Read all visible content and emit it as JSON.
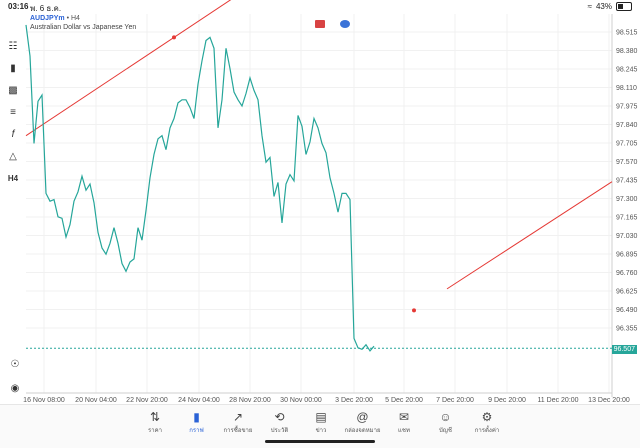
{
  "status_bar": {
    "time": "03:16",
    "date": "พ. 6 ธ.ค.",
    "battery_text": "43%",
    "battery_level": 0.43
  },
  "chart": {
    "symbol": "AUDJPYm",
    "timeframe": "• H4",
    "description": "Australian Dollar vs Japanese Yen",
    "current_price": "96.507",
    "colors": {
      "line": "#26a69a",
      "trendline": "#e53935",
      "grid": "#f1f1f1"
    }
  },
  "toolbar": [
    "crosshair-icon",
    "chart-type-icon",
    "indicators-icon",
    "objects-icon",
    "fx-icon",
    "shapes-icon",
    "H4"
  ],
  "tabs": [
    {
      "label": "ราคา",
      "icon": "arrows-icon",
      "active": false
    },
    {
      "label": "กราฟ",
      "icon": "candles-icon",
      "active": true
    },
    {
      "label": "การซื้อขาย",
      "icon": "trade-chart-icon",
      "active": false
    },
    {
      "label": "ประวัติ",
      "icon": "history-icon",
      "active": false
    },
    {
      "label": "ข่าว",
      "icon": "news-icon",
      "active": false
    },
    {
      "label": "กล่องจดหมาย",
      "icon": "mail-icon",
      "active": false
    },
    {
      "label": "แชท",
      "icon": "chat-icon",
      "active": false
    },
    {
      "label": "บัญชี",
      "icon": "account-icon",
      "active": false
    },
    {
      "label": "การตั้งค่า",
      "icon": "settings-icon",
      "active": false
    }
  ],
  "chart_data": {
    "type": "line",
    "title": "AUDJPYm • H4",
    "ylim": [
      96.22,
      98.65
    ],
    "y_ticks": [
      "98.515",
      "98.380",
      "98.245",
      "98.110",
      "97.975",
      "97.840",
      "97.705",
      "97.570",
      "97.435",
      "97.300",
      "97.165",
      "97.030",
      "96.895",
      "96.760",
      "96.625",
      "96.490",
      "96.355"
    ],
    "x_ticks": [
      "16 Nov 08:00",
      "20 Nov 04:00",
      "22 Nov 20:00",
      "24 Nov 04:00",
      "28 Nov 20:00",
      "30 Nov 00:00",
      "3 Dec 20:00",
      "5 Dec 20:00",
      "7 Dec 20:00",
      "9 Dec 20:00",
      "11 Dec 20:00",
      "13 Dec 20:00"
    ],
    "current_price": 96.507,
    "series": [
      {
        "values": [
          98.58,
          98.38,
          97.82,
          98.09,
          98.13,
          97.5,
          97.45,
          97.46,
          97.35,
          97.34,
          97.22,
          97.3,
          97.45,
          97.51,
          97.61,
          97.52,
          97.56,
          97.44,
          97.25,
          97.15,
          97.11,
          97.18,
          97.28,
          97.18,
          97.05,
          97.0,
          97.06,
          97.08,
          97.28,
          97.2,
          97.39,
          97.6,
          97.75,
          97.85,
          97.87,
          97.78,
          97.92,
          97.98,
          98.08,
          98.1,
          98.1,
          98.05,
          97.98,
          98.2,
          98.35,
          98.48,
          98.5,
          98.43,
          97.92,
          98.1,
          98.43,
          98.3,
          98.15,
          98.1,
          98.06,
          98.14,
          98.24,
          98.16,
          98.1,
          97.87,
          97.7,
          97.73,
          97.48,
          97.57,
          97.31,
          97.56,
          97.62,
          97.58,
          98.0,
          97.93,
          97.75,
          97.83,
          97.98,
          97.92,
          97.82,
          97.76,
          97.6,
          97.5,
          97.38,
          97.5,
          97.5,
          97.46,
          96.57,
          96.51,
          96.5,
          96.53,
          96.49,
          96.52
        ]
      }
    ],
    "trendlines": [
      {
        "points": [
          [
            0,
            97.87
          ],
          [
            37,
            98.5
          ]
        ]
      },
      {
        "points": [
          [
            70,
            96.3
          ],
          [
            97,
            96.75
          ]
        ]
      }
    ]
  }
}
